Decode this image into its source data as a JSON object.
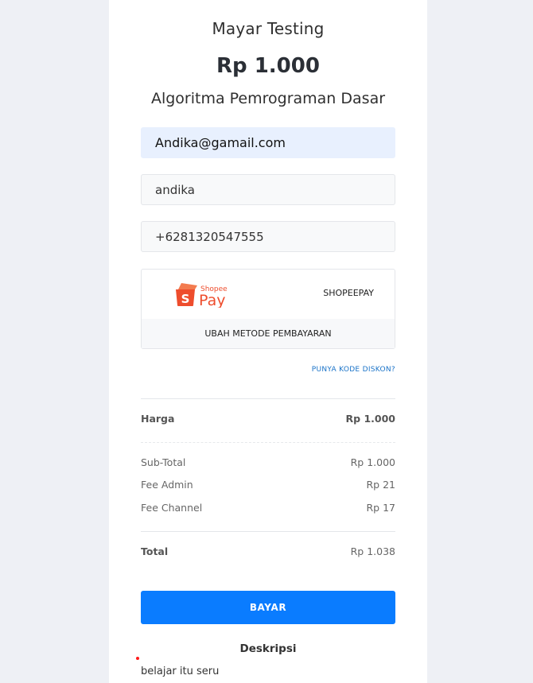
{
  "header": {
    "store_name": "Mayar Testing",
    "price": "Rp 1.000",
    "product": "Algoritma Pemrograman Dasar"
  },
  "form": {
    "email_value": "Andika@gamail.com",
    "name_value": "andika",
    "phone_value": "+6281320547555"
  },
  "payment": {
    "logo_icon": "shopeepay-logo-icon",
    "logo_small_text": "Shopee",
    "logo_big_text": "Pay",
    "method_name": "SHOPEEPAY",
    "change_label": "UBAH METODE PEMBAYARAN"
  },
  "discount_link": "PUNYA KODE DISKON?",
  "summary": {
    "harga_label": "Harga",
    "harga_value": "Rp 1.000",
    "subtotal_label": "Sub-Total",
    "subtotal_value": "Rp 1.000",
    "fee_admin_label": "Fee Admin",
    "fee_admin_value": "Rp 21",
    "fee_channel_label": "Fee Channel",
    "fee_channel_value": "Rp 17",
    "total_label": "Total",
    "total_value": "Rp 1.038"
  },
  "pay_button_label": "BAYAR",
  "description": {
    "title": "Deskripsi",
    "text": "belajar itu seru"
  },
  "colors": {
    "accent": "#0a7cff",
    "shopee_orange": "#ee4d2d",
    "link": "#1a73c8",
    "autofill_bg": "#e8f0fe"
  }
}
